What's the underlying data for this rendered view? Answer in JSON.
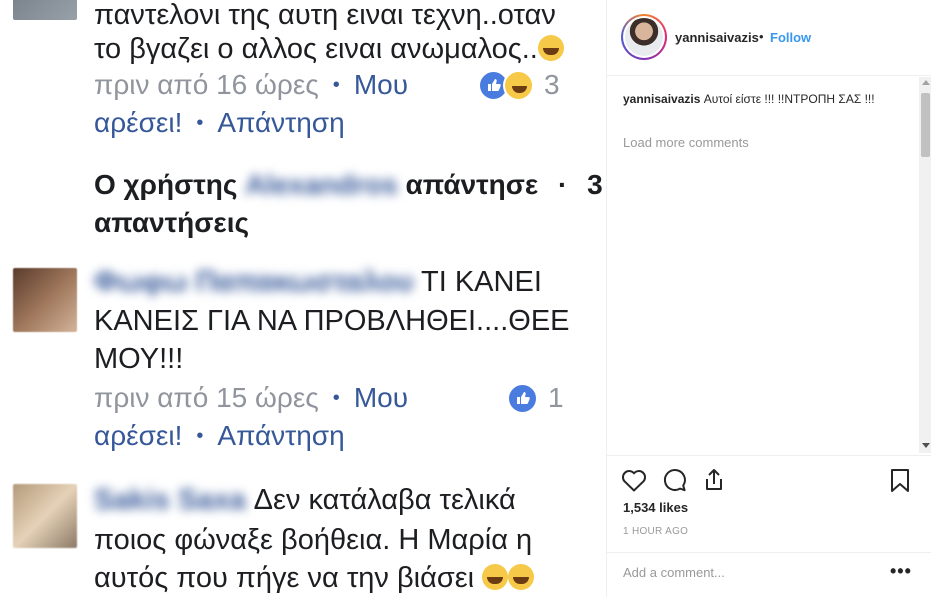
{
  "post_image": {
    "comment1": {
      "line1": "παντελονι της αυτη ειναι τεχνη..οταν",
      "line2": "το βγαζει ο αλλος ειναι ανωμαλος..",
      "time": "πριν από 16 ώρες",
      "like_part1": "Μου",
      "like_part2": "αρέσει!",
      "reply": "Απάντηση",
      "reaction_count": "3"
    },
    "replies_summary": {
      "prefix": "Ο χρήστης",
      "blurred_name": "Alexandros",
      "suffix": "απάντησε",
      "dot": "·",
      "count": "3",
      "count_label": "απαντήσεις"
    },
    "comment2": {
      "blurred_name": "Φωφω Παπακωσταλου",
      "line1": "ΤΙ ΚΑΝΕΙ",
      "line2": "ΚΑΝΕΙΣ ΓΙΑ ΝΑ ΠΡΟΒΛΗΘΕΙ....ΘΕΕ",
      "line3": "ΜΟΥ!!!",
      "time": "πριν από 15 ώρες",
      "like_part1": "Μου",
      "like_part2": "αρέσει!",
      "reply": "Απάντηση",
      "reaction_count": "1"
    },
    "comment3": {
      "blurred_name": "Sakis Saxa",
      "line1": "Δεν κατάλαβα τελικά",
      "line2": "ποιος φώναξε βοήθεια. Η Μαρία η",
      "line3": "αυτός που πήγε να την βιάσει"
    },
    "dot": "•"
  },
  "instagram": {
    "username": "yannisaivazis",
    "separator": "•",
    "follow_label": "Follow",
    "caption_user": "yannisaivazis",
    "caption_text": "Αυτοί είστε !!! !!ΝΤΡΟΠΗ ΣΑΣ !!!",
    "load_more": "Load more comments",
    "likes": "1,534 likes",
    "time": "1 HOUR AGO",
    "add_comment_placeholder": "Add a comment...",
    "more_options": "•••",
    "icons": [
      "heart-icon",
      "comment-icon",
      "share-icon",
      "bookmark-icon"
    ]
  },
  "colors": {
    "link_blue": "#365899",
    "follow_blue": "#3897f0",
    "fb_text": "#1c1e21",
    "fb_meta_gray": "#90949c",
    "like_blue": "#4a7ce0"
  }
}
